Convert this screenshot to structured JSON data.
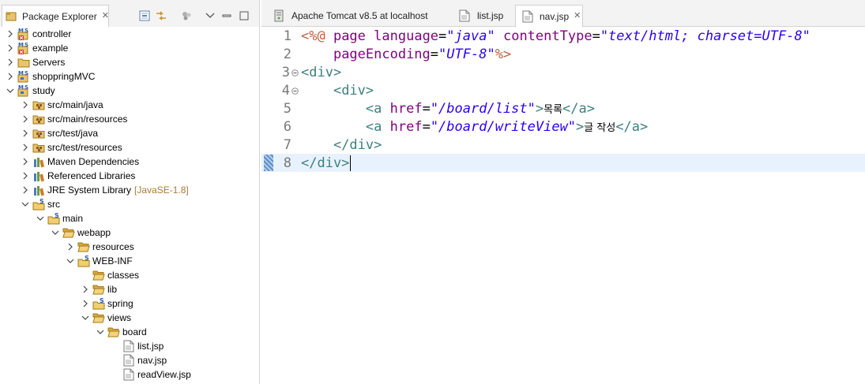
{
  "explorer": {
    "title": "Package Explorer",
    "tree": [
      {
        "label": "controller",
        "depth": 0,
        "arrow": "right",
        "icon": "maven-project-error-icon"
      },
      {
        "label": "example",
        "depth": 0,
        "arrow": "right",
        "icon": "maven-project-error-icon"
      },
      {
        "label": "Servers",
        "depth": 0,
        "arrow": "right",
        "icon": "folder-icon"
      },
      {
        "label": "shoppringMVC",
        "depth": 0,
        "arrow": "right",
        "icon": "maven-project-icon"
      },
      {
        "label": "study",
        "depth": 0,
        "arrow": "down",
        "icon": "maven-project-icon"
      },
      {
        "label": "src/main/java",
        "depth": 1,
        "arrow": "right",
        "icon": "source-folder-icon"
      },
      {
        "label": "src/main/resources",
        "depth": 1,
        "arrow": "right",
        "icon": "source-folder-icon"
      },
      {
        "label": "src/test/java",
        "depth": 1,
        "arrow": "right",
        "icon": "source-folder-icon"
      },
      {
        "label": "src/test/resources",
        "depth": 1,
        "arrow": "right",
        "icon": "source-folder-icon"
      },
      {
        "label": "Maven Dependencies",
        "depth": 1,
        "arrow": "right",
        "icon": "library-icon"
      },
      {
        "label": "Referenced Libraries",
        "depth": 1,
        "arrow": "right",
        "icon": "library-icon"
      },
      {
        "label": "JRE System Library",
        "decoration": "[JavaSE-1.8]",
        "depth": 1,
        "arrow": "right",
        "icon": "library-icon"
      },
      {
        "label": "src",
        "depth": 1,
        "arrow": "down",
        "icon": "spring-folder-icon"
      },
      {
        "label": "main",
        "depth": 2,
        "arrow": "down",
        "icon": "spring-folder-icon"
      },
      {
        "label": "webapp",
        "depth": 3,
        "arrow": "down",
        "icon": "open-folder-icon"
      },
      {
        "label": "resources",
        "depth": 4,
        "arrow": "right",
        "icon": "open-folder-icon"
      },
      {
        "label": "WEB-INF",
        "depth": 4,
        "arrow": "down",
        "icon": "spring-folder-icon"
      },
      {
        "label": "classes",
        "depth": 5,
        "arrow": "none",
        "icon": "open-folder-icon"
      },
      {
        "label": "lib",
        "depth": 5,
        "arrow": "right",
        "icon": "open-folder-icon"
      },
      {
        "label": "spring",
        "depth": 5,
        "arrow": "right",
        "icon": "spring-folder-icon"
      },
      {
        "label": "views",
        "depth": 5,
        "arrow": "down",
        "icon": "open-folder-icon"
      },
      {
        "label": "board",
        "depth": 6,
        "arrow": "down",
        "icon": "open-folder-icon"
      },
      {
        "label": "list.jsp",
        "depth": 7,
        "arrow": "none",
        "icon": "file-icon"
      },
      {
        "label": "nav.jsp",
        "depth": 7,
        "arrow": "none",
        "icon": "file-icon"
      },
      {
        "label": "readView.jsp",
        "depth": 7,
        "arrow": "none",
        "icon": "file-icon"
      }
    ]
  },
  "editor": {
    "tabs": [
      {
        "label": "Apache Tomcat v8.5   at localhost",
        "icon": "server-icon",
        "active": false
      },
      {
        "label": "list.jsp",
        "icon": "file-icon",
        "active": false
      },
      {
        "label": "nav.jsp",
        "icon": "file-icon",
        "active": true
      }
    ],
    "lines": [
      {
        "n": "1",
        "tokens": [
          [
            "dir",
            "<%@ "
          ],
          [
            "attr",
            "page"
          ],
          [
            "plain",
            " "
          ],
          [
            "attr",
            "language"
          ],
          [
            "plain",
            "="
          ],
          [
            "str",
            "\"java\""
          ],
          [
            "plain",
            " "
          ],
          [
            "attr",
            "contentType"
          ],
          [
            "plain",
            "="
          ],
          [
            "str",
            "\"text/html; charset=UTF-8\""
          ]
        ]
      },
      {
        "n": "2",
        "tokens": [
          [
            "plain",
            "    "
          ],
          [
            "attr",
            "pageEncoding"
          ],
          [
            "plain",
            "="
          ],
          [
            "str",
            "\"UTF-8\""
          ],
          [
            "dir",
            "%>"
          ]
        ]
      },
      {
        "n": "3",
        "fold": true,
        "tokens": [
          [
            "tag",
            "<div>"
          ]
        ]
      },
      {
        "n": "4",
        "fold": true,
        "tokens": [
          [
            "plain",
            "    "
          ],
          [
            "tag",
            "<div>"
          ]
        ]
      },
      {
        "n": "5",
        "tokens": [
          [
            "plain",
            "        "
          ],
          [
            "tag",
            "<a "
          ],
          [
            "attr",
            "href"
          ],
          [
            "plain",
            "="
          ],
          [
            "str",
            "\"/board/list\""
          ],
          [
            "tag",
            ">"
          ],
          [
            "text",
            "목록"
          ],
          [
            "tag",
            "</a>"
          ]
        ]
      },
      {
        "n": "6",
        "tokens": [
          [
            "plain",
            "        "
          ],
          [
            "tag",
            "<a "
          ],
          [
            "attr",
            "href"
          ],
          [
            "plain",
            "="
          ],
          [
            "str",
            "\"/board/writeView\""
          ],
          [
            "tag",
            ">"
          ],
          [
            "text",
            "글 작성"
          ],
          [
            "tag",
            "</a>"
          ]
        ]
      },
      {
        "n": "7",
        "tokens": [
          [
            "plain",
            "    "
          ],
          [
            "tag",
            "</div>"
          ]
        ]
      },
      {
        "n": "8",
        "current": true,
        "tokens": [
          [
            "tag",
            "</div>"
          ]
        ]
      }
    ]
  }
}
